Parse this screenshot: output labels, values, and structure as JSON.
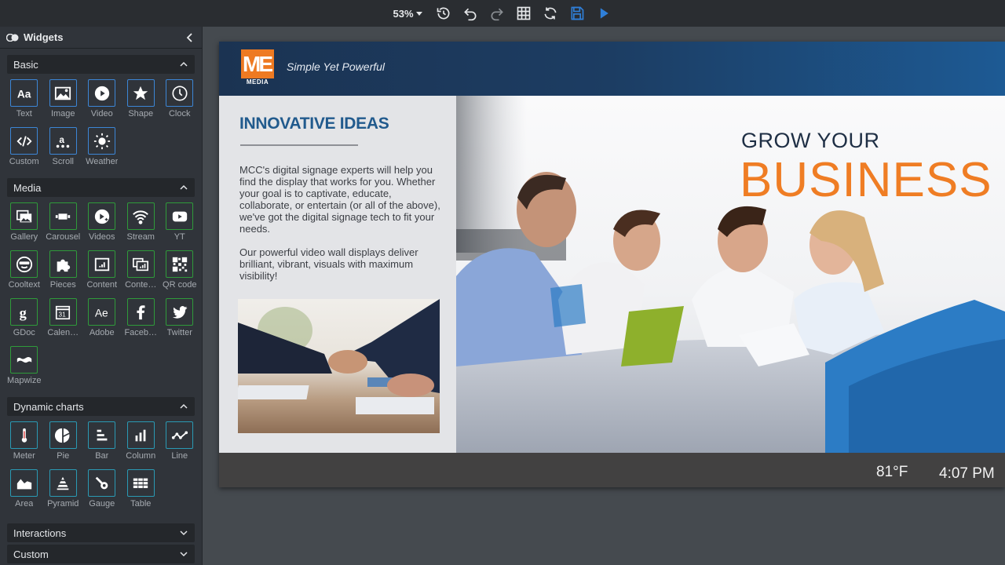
{
  "toolbar": {
    "zoom_level": "53%",
    "buttons": [
      {
        "name": "history",
        "icon": "history-icon"
      },
      {
        "name": "undo",
        "icon": "undo-icon"
      },
      {
        "name": "redo",
        "icon": "redo-icon"
      },
      {
        "name": "grid",
        "icon": "grid-icon"
      },
      {
        "name": "refresh",
        "icon": "refresh-icon"
      },
      {
        "name": "save",
        "icon": "save-icon"
      },
      {
        "name": "preview",
        "icon": "play-icon"
      }
    ],
    "colors": {
      "accent": "#2f7fd8",
      "icon": "#e6e8ea"
    }
  },
  "sidebar": {
    "title": "Widgets",
    "sections": [
      {
        "label": "Basic",
        "expanded": true,
        "color": "#3c86d6",
        "items": [
          {
            "label": "Text",
            "icon": "text-icon"
          },
          {
            "label": "Image",
            "icon": "image-icon"
          },
          {
            "label": "Video",
            "icon": "video-icon"
          },
          {
            "label": "Shape",
            "icon": "star-icon"
          },
          {
            "label": "Clock",
            "icon": "clock-icon"
          },
          {
            "label": "Custom",
            "icon": "code-icon"
          },
          {
            "label": "Scroll",
            "icon": "scroll-icon"
          },
          {
            "label": "Weather",
            "icon": "sun-icon"
          }
        ]
      },
      {
        "label": "Media",
        "expanded": true,
        "color": "#2f9b3a",
        "items": [
          {
            "label": "Gallery",
            "icon": "gallery-icon"
          },
          {
            "label": "Carousel",
            "icon": "carousel-icon"
          },
          {
            "label": "Videos",
            "icon": "videos-icon"
          },
          {
            "label": "Stream",
            "icon": "wifi-icon"
          },
          {
            "label": "YT",
            "icon": "youtube-icon"
          },
          {
            "label": "Cooltext",
            "icon": "sunglasses-icon"
          },
          {
            "label": "Pieces",
            "icon": "puzzle-icon"
          },
          {
            "label": "Content",
            "icon": "content-icon"
          },
          {
            "label": "Conte…",
            "icon": "content-multi-icon"
          },
          {
            "label": "QR code",
            "icon": "qr-icon"
          },
          {
            "label": "GDoc",
            "icon": "google-icon"
          },
          {
            "label": "Calen…",
            "icon": "calendar-icon"
          },
          {
            "label": "Adobe",
            "icon": "adobe-icon"
          },
          {
            "label": "Faceb…",
            "icon": "facebook-icon"
          },
          {
            "label": "Twitter",
            "icon": "twitter-icon"
          },
          {
            "label": "Mapwize",
            "icon": "map-icon"
          }
        ]
      },
      {
        "label": "Dynamic charts",
        "expanded": true,
        "color": "#2a9ab4",
        "items": [
          {
            "label": "Meter",
            "icon": "thermometer-icon"
          },
          {
            "label": "Pie",
            "icon": "pie-chart-icon"
          },
          {
            "label": "Bar",
            "icon": "bar-chart-icon"
          },
          {
            "label": "Column",
            "icon": "column-chart-icon"
          },
          {
            "label": "Line",
            "icon": "line-chart-icon"
          },
          {
            "label": "Area",
            "icon": "area-chart-icon"
          },
          {
            "label": "Pyramid",
            "icon": "pyramid-icon"
          },
          {
            "label": "Gauge",
            "icon": "gauge-icon"
          },
          {
            "label": "Table",
            "icon": "table-icon"
          }
        ]
      },
      {
        "label": "Interactions",
        "expanded": false,
        "items": []
      },
      {
        "label": "Custom",
        "expanded": false,
        "items": []
      }
    ]
  },
  "slide": {
    "logo_text": "ME",
    "logo_sub": "MEDIA",
    "tagline": "Simple Yet Powerful",
    "heading": "INNOVATIVE IDEAS",
    "paragraphs": [
      "MCC's digital signage experts will help you find the display that works for you. Whether your goal is to captivate, educate, collaborate, or entertain (or all of the above), we've got the digital signage tech to fit your needs.",
      "Our powerful video wall displays deliver brilliant, vibrant, visuals with maximum visibility!"
    ],
    "hero_line1": "GROW YOUR",
    "hero_line2": "BUSINESS",
    "temperature": "81°F",
    "time": "4:07 PM",
    "colors": {
      "brand_orange": "#ef7d24",
      "header_blue": "#1c3d63",
      "heading_blue": "#215a8d"
    }
  }
}
